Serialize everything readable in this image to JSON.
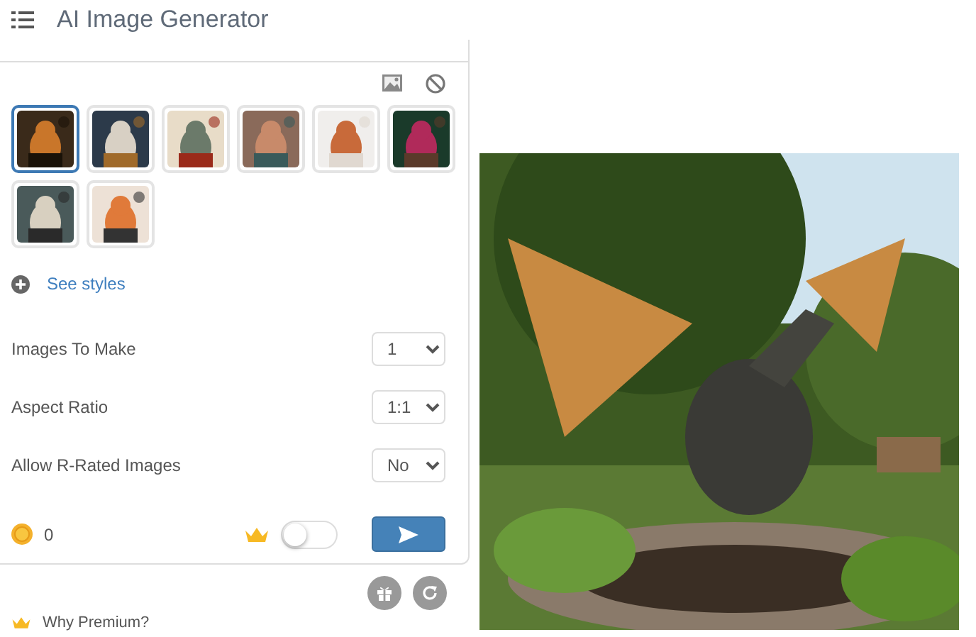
{
  "header": {
    "title": "AI Image Generator"
  },
  "styles": [
    {
      "kind": "picture",
      "selected": true
    },
    {
      "kind": "picture",
      "selected": false
    },
    {
      "kind": "picture",
      "selected": false
    },
    {
      "kind": "picture",
      "selected": false
    },
    {
      "kind": "picture",
      "selected": false
    },
    {
      "kind": "picture",
      "selected": false
    },
    {
      "kind": "picture",
      "selected": false
    },
    {
      "kind": "picture",
      "selected": false
    }
  ],
  "see_styles": "See styles",
  "settings": [
    {
      "label": "Images To Make",
      "value": "1"
    },
    {
      "label": "Aspect Ratio",
      "value": "1:1"
    },
    {
      "label": "Allow R-Rated Images",
      "value": "No"
    }
  ],
  "credits": "0",
  "premium_toggle": {
    "on": false
  },
  "premium_link": "Why Premium?",
  "result": {
    "kind": "picture"
  }
}
